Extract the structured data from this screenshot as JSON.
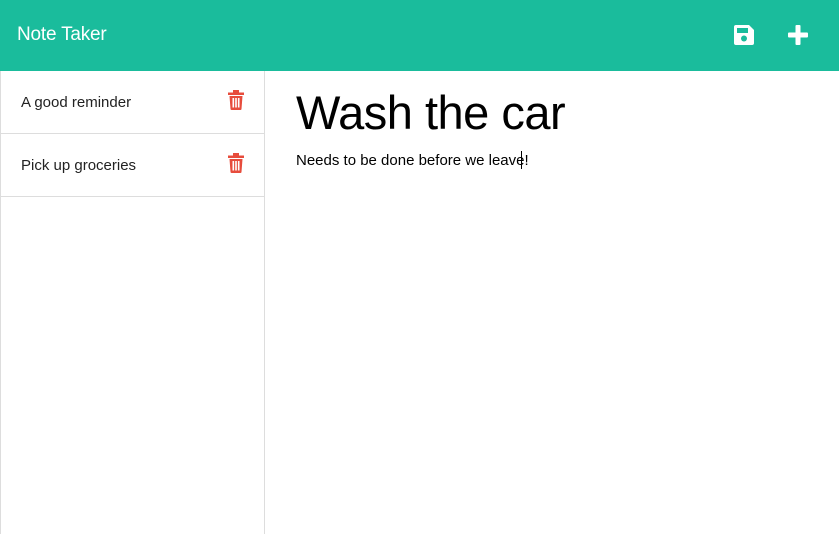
{
  "app": {
    "brand": "Note Taker",
    "save_icon": "save-icon",
    "add_icon": "plus-icon",
    "nav_color": "#1abc9c",
    "delete_color": "#e74c3c"
  },
  "notes": [
    {
      "title": "A good reminder",
      "delete_icon": "trash-icon"
    },
    {
      "title": "Pick up groceries",
      "delete_icon": "trash-icon"
    }
  ],
  "editor": {
    "title": "Wash the car",
    "text": "Needs to be done before we leave!"
  }
}
